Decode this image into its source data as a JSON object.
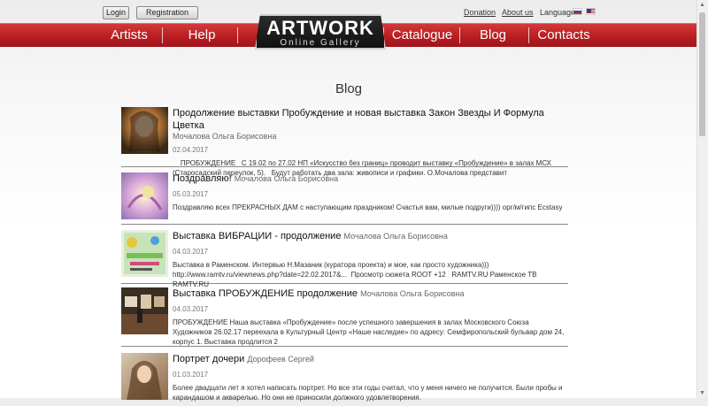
{
  "header": {
    "login_label": "Login",
    "registration_label": "Registration",
    "donation_label": "Donation",
    "about_label": "About us",
    "language_label": "Language",
    "flags": [
      "russian-flag-icon",
      "us-flag-icon"
    ]
  },
  "logo": {
    "title": "ARTWORK",
    "subtitle": "Online Gallery"
  },
  "nav": {
    "artists": "Artists",
    "help": "Help",
    "catalogue": "Catalogue",
    "blog": "Blog",
    "contacts": "Contacts"
  },
  "page": {
    "title": "Blog"
  },
  "posts": [
    {
      "title": "Продолжение выставки Пробуждение и новая выставка Закон Звезды И Формула Цветка",
      "author": "Мочалова Ольга Борисовна",
      "date": "02.04.2017",
      "text": "    ПРОБУЖДЕНИЕ   С 19.02 по 27.02 НП «Искусство без границ» проводит выставку «Пробуждение» в залах МСХ (Старосадский переулок, 5).   Будут работать два зала: живописи и графики. О.Мочалова представит"
    },
    {
      "title": "Поздравляю!",
      "author": "Мочалова Ольга Борисовна",
      "date": "05.03.2017",
      "text": "Поздравляю всех ПРЕКРАСНЫХ ДАМ с наступающим праздником! Счастья вам, милые подруги)))) орг/м/гипс Ecstasy"
    },
    {
      "title": "Выставка ВИБРАЦИИ - продолжение",
      "author": "Мочалова Ольга Борисовна",
      "date": "04.03.2017",
      "text": "Выставка в Раменском. Интервью Н.Мазаник (куратора проекта) и мое, как просто художника)))\nhttp://www.ramtv.ru/viewnews.php?date=22.02.2017&...  Просмотр сюжета ROOT +12   RAMTV.RU Раменское ТВ RAMTV.RU"
    },
    {
      "title": "Выставка ПРОБУЖДЕНИЕ продолжение",
      "author": "Мочалова Ольга Борисовна",
      "date": "04.03.2017",
      "text": "ПРОБУЖДЕНИЕ Наша выставка «Пробуждение» после успешного завершения в залах Московского Союза Художников 26.02.17 переехала в Культурный Центр «Наше наследие» по адресу: Семфиропольский бульвар дом 24, корпус 1. Выставка продлится 2"
    },
    {
      "title": "Портрет дочери",
      "author": "Дорофеев Сергей",
      "date": "01.03.2017",
      "text": "Более двадцати лет я хотел написать портрет. Но все эти годы считал, что у меня ничего не получится. Были пробы и карандашом и акварелью. Но они не приносили должного удовлетворения."
    }
  ]
}
